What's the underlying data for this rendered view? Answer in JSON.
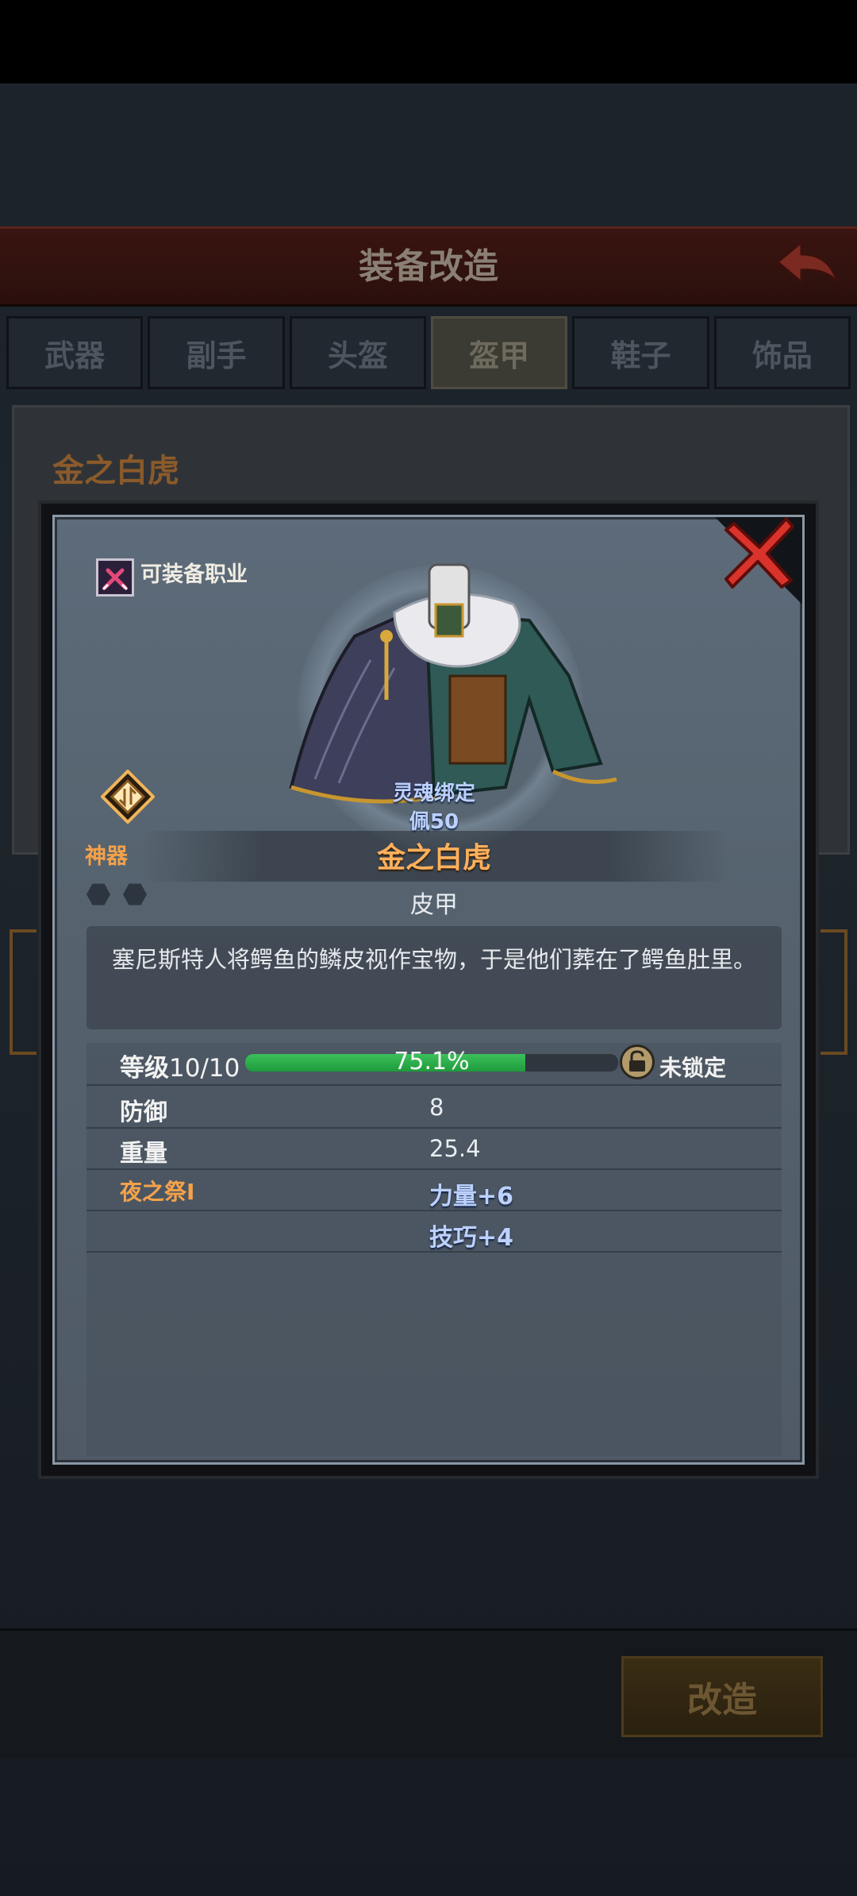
{
  "screen": {
    "title": "装备改造",
    "tabs": [
      {
        "label": "武器",
        "active": false
      },
      {
        "label": "副手",
        "active": false
      },
      {
        "label": "头盔",
        "active": false
      },
      {
        "label": "盔甲",
        "active": true
      },
      {
        "label": "鞋子",
        "active": false
      },
      {
        "label": "饰品",
        "active": false
      }
    ],
    "item_name": "金之白虎",
    "action_button": "改造"
  },
  "modal": {
    "class_label": "可装备职业",
    "soul_bind": "灵魂绑定",
    "wear_level": "佩50",
    "rarity_label": "神器",
    "item_name": "金之白虎",
    "item_type": "皮甲",
    "description": "塞尼斯特人将鳄鱼的鳞皮视作宝物，于是他们葬在了鳄鱼肚里。",
    "level": {
      "label": "等级",
      "value": "10/10",
      "progress_text": "75.1%",
      "progress": 0.751,
      "lock_label": "未锁定"
    },
    "stats": [
      {
        "name": "防御",
        "value": "8"
      },
      {
        "name": "重量",
        "value": "25.4"
      }
    ],
    "enchant": {
      "name": "夜之祭I",
      "effects": [
        "力量+6",
        "技巧+4"
      ]
    },
    "gems_count": 2
  },
  "colors": {
    "accent_orange": "#f4a24a",
    "bonus_blue": "#bcd1ff",
    "close_red": "#d9332b",
    "progress_green": "#2fb04e"
  },
  "icons": {
    "close": "close-x-icon",
    "class": "class-sword-icon",
    "rarity": "artifact-diamond-icon",
    "lock": "padlock-icon",
    "back": "back-arrow-icon"
  }
}
